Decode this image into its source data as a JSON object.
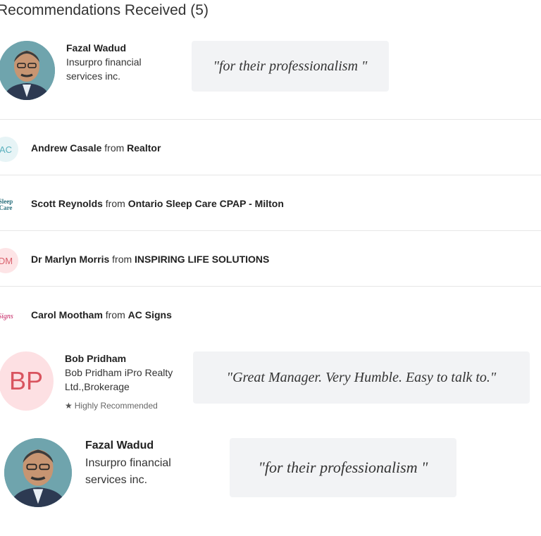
{
  "heading": "Recommendations Received (5)",
  "recommendations_top": {
    "name": "Fazal Wadud",
    "company": "Insurpro financial services inc.",
    "quote": "\"for their professionalism \""
  },
  "rows": [
    {
      "initials": "AC",
      "name": "Andrew Casale",
      "from": "from",
      "company": "Realtor",
      "color": "#e7f4f6",
      "text_color": "#5ab0bd"
    },
    {
      "initials": "Sleep Care",
      "name": "Scott Reynolds",
      "from": "from",
      "company": "Ontario Sleep Care CPAP - Milton",
      "color": "#ffffff",
      "text_color": "#2a6f7c"
    },
    {
      "initials": "DM",
      "name": "Dr Marlyn Morris",
      "from": "from",
      "company": "INSPIRING LIFE SOLUTIONS",
      "color": "#fde4e6",
      "text_color": "#d9606c"
    },
    {
      "initials": "Signs",
      "name": "Carol Mootham",
      "from": "from",
      "company": "AC Signs",
      "color": "#ffffff",
      "text_color": "#c2185b"
    }
  ],
  "bob": {
    "initials": "BP",
    "name": "Bob Pridham",
    "company": "Bob Pridham iPro Realty Ltd.,Brokerage",
    "badge": "Highly Recommended",
    "quote": "\"Great Manager. Very Humble. Easy to talk to.\""
  },
  "recommendations_bottom": {
    "name": "Fazal Wadud",
    "company": "Insurpro financial services inc.",
    "quote": "\"for their professionalism \""
  }
}
